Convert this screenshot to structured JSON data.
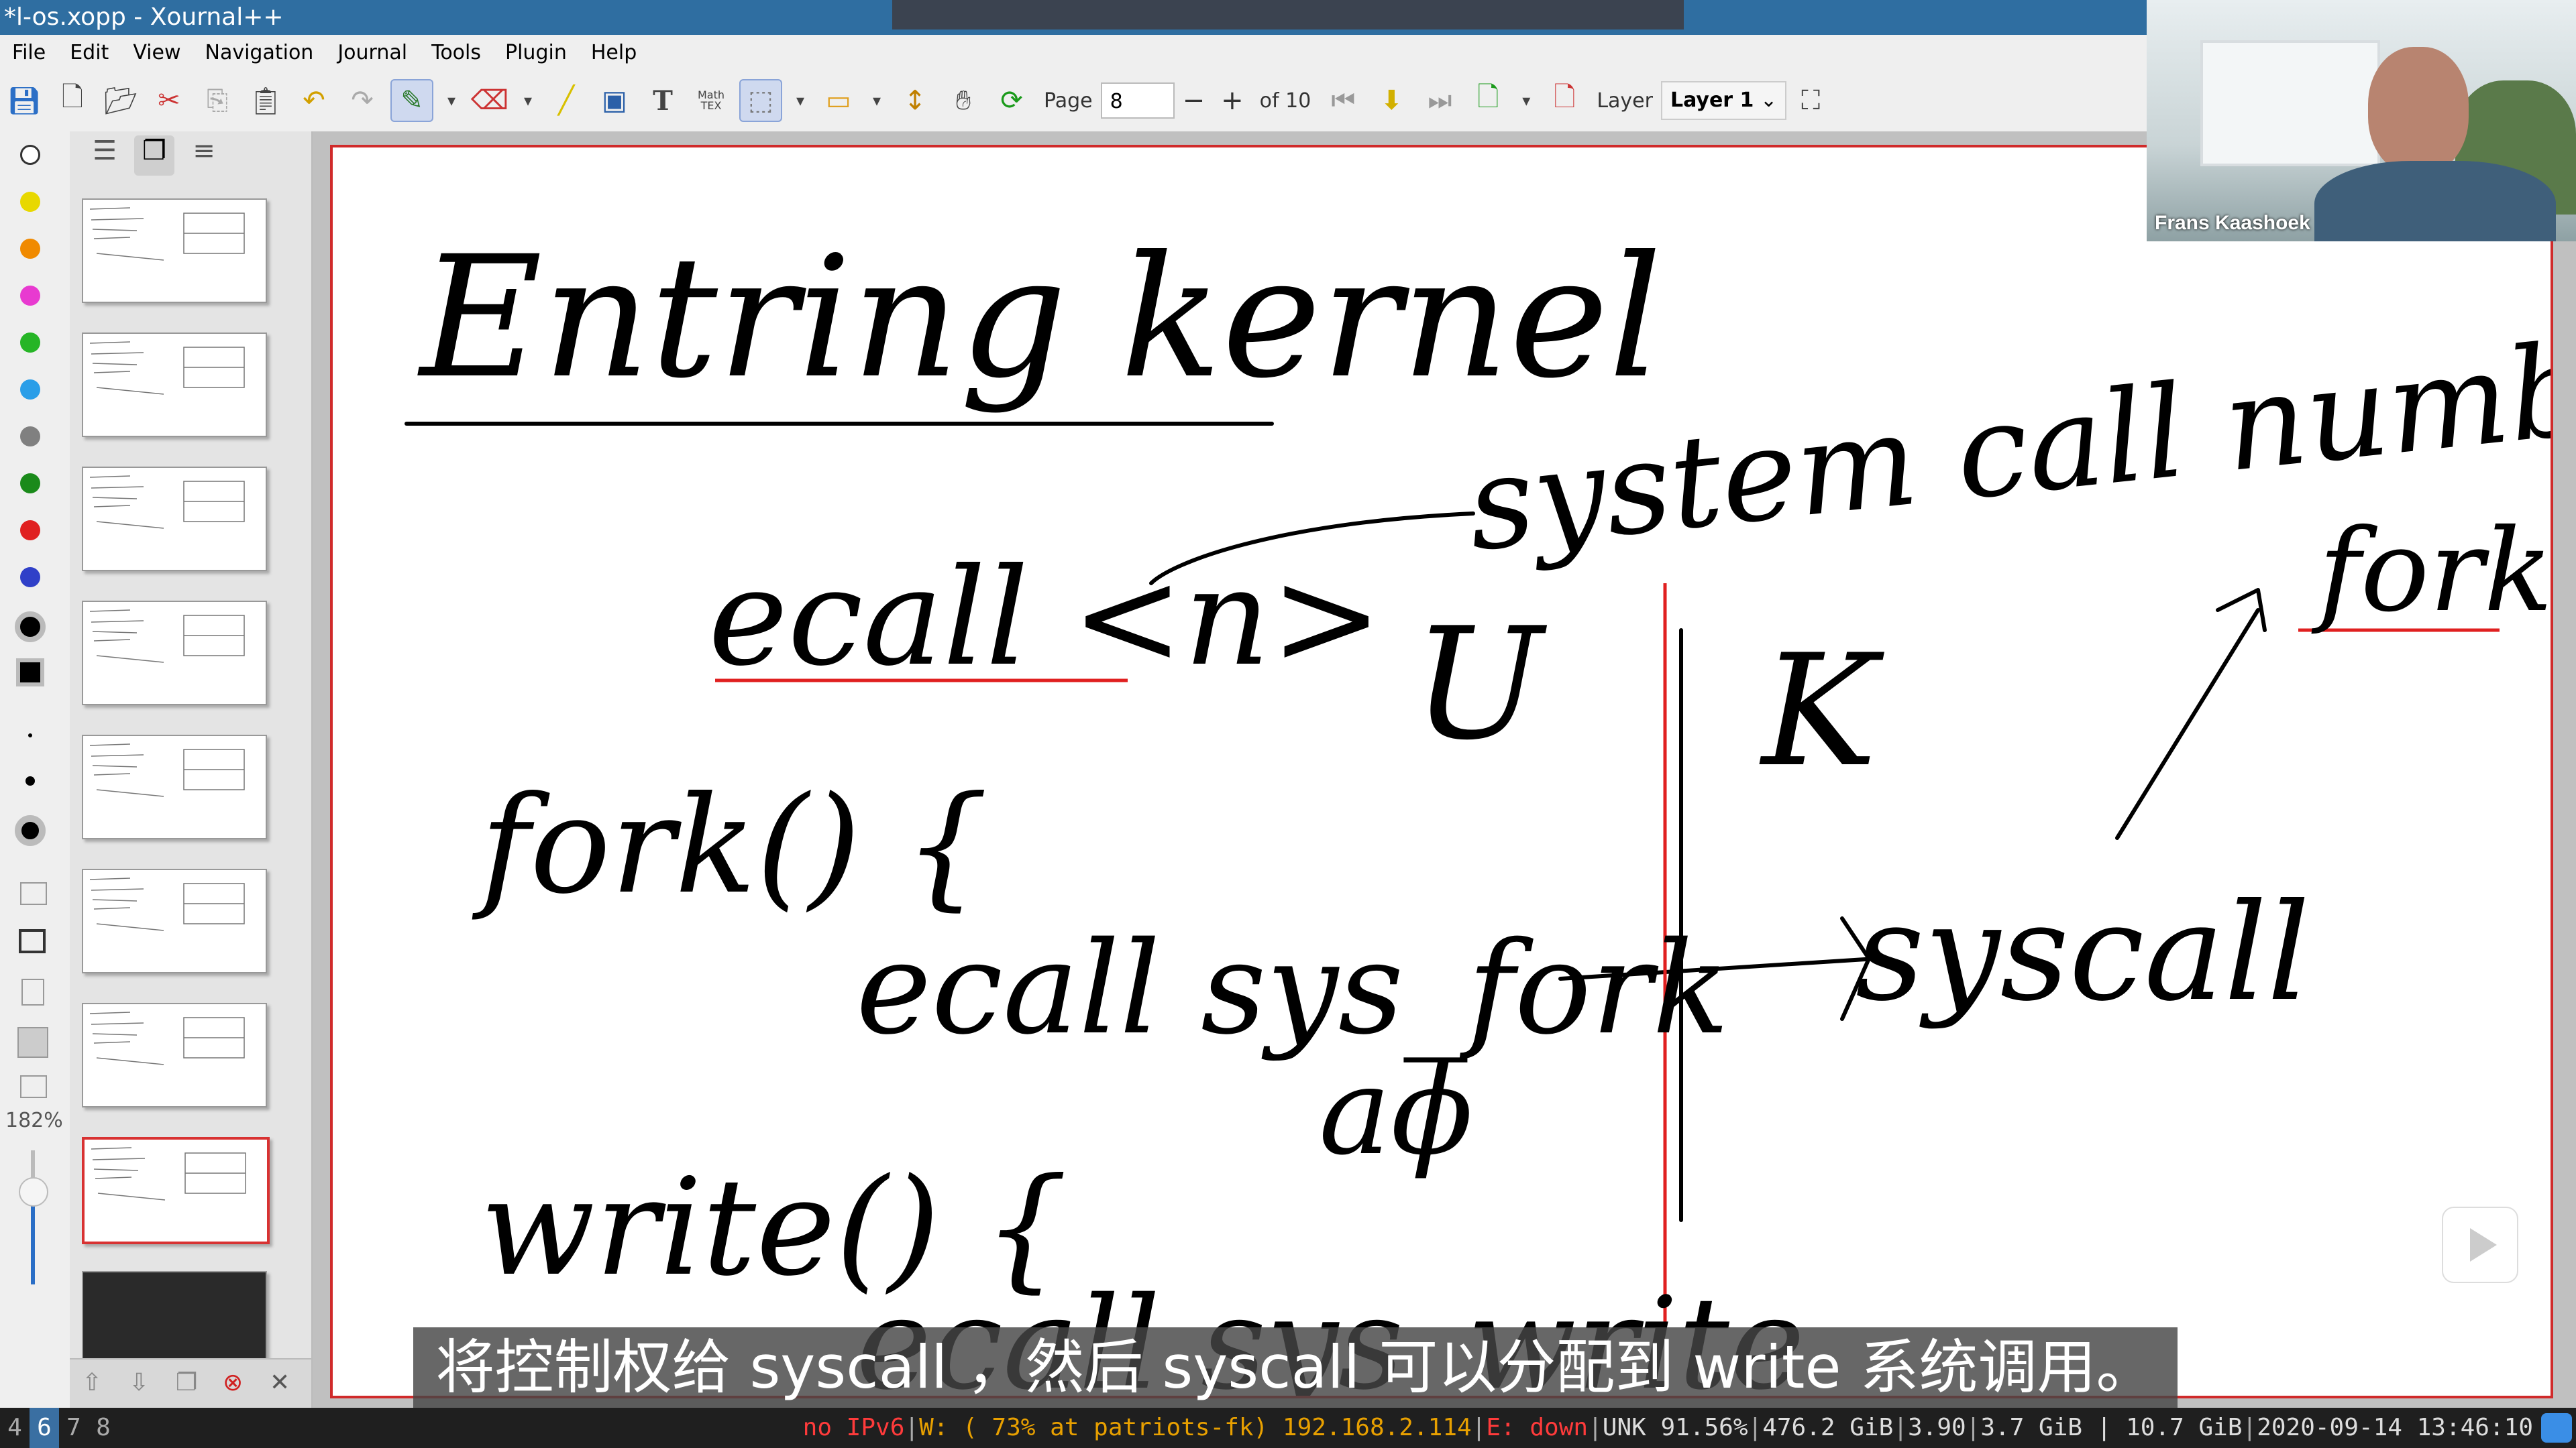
{
  "window": {
    "title": "*l-os.xopp - Xournal++"
  },
  "menu": [
    "File",
    "Edit",
    "View",
    "Navigation",
    "Journal",
    "Tools",
    "Plugin",
    "Help"
  ],
  "toolbar": {
    "page_label": "Page",
    "page_value": "8",
    "minus": "−",
    "plus": "+",
    "of_pages": "of 10",
    "layer_label": "Layer",
    "layer_value": "Layer 1",
    "math_label": "Math\nTEX"
  },
  "sidebar": {
    "zoom": "182%",
    "current_page": 8,
    "page_count": 9
  },
  "colors": {
    "palette": [
      "#ffffff",
      "#e8d800",
      "#f08a00",
      "#e83ad0",
      "#26b526",
      "#2a9ee8",
      "#808080",
      "#1a8a1a",
      "#e02020",
      "#3040c8",
      "#000000"
    ],
    "accent": "#2f6ea1",
    "page_border": "#d02a2a"
  },
  "canvas": {
    "handwriting": {
      "title": "Entring kernel",
      "line1": "ecall <n>",
      "syscall_number": "system call number",
      "fork_block": "fork() {",
      "ecall_fork": "ecall sys_fork",
      "write_block": "write() {",
      "ecall_write": "ecall sys_write",
      "u": "U",
      "k": "K",
      "syscall": "syscall",
      "fork_right": "fork",
      "afork": "aϕ"
    }
  },
  "video": {
    "name": "Frans Kaashoek"
  },
  "subtitle": "将控制权给 syscall ，然后 syscall 可以分配到 write 系统调用。",
  "statusbar": {
    "workspaces": [
      "4",
      "6",
      "7",
      "8"
    ],
    "current_workspace": "6",
    "ipv6": "no IPv6",
    "wifi": "W: ( 73% at patriots-fk) 192.168.2.114",
    "eth": "E: down",
    "battery": "UNK 91.56%",
    "disk": "476.2 GiB",
    "load": "3.90",
    "mem": "3.7 GiB | 10.7 GiB",
    "datetime": "2020-09-14 13:46:10"
  }
}
